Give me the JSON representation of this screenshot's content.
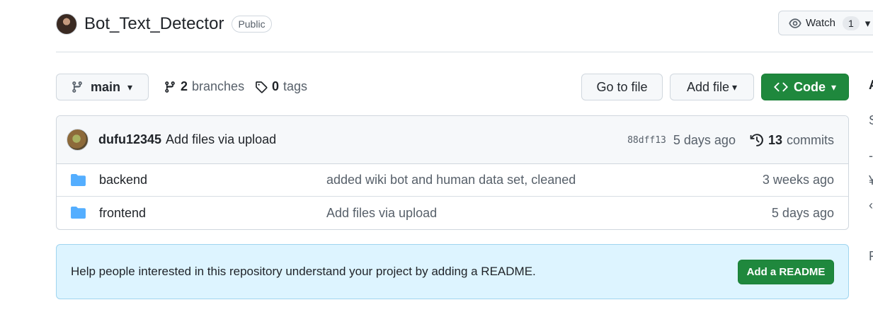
{
  "repo": {
    "name": "Bot_Text_Detector",
    "visibility": "Public"
  },
  "watch": {
    "label": "Watch",
    "count": "1"
  },
  "toolbar": {
    "branch": "main",
    "branches_count": "2",
    "branches_label": "branches",
    "tags_count": "0",
    "tags_label": "tags",
    "goto_file": "Go to file",
    "add_file": "Add file",
    "code": "Code"
  },
  "latest_commit": {
    "author": "dufu12345",
    "message": "Add files via upload",
    "sha": "88dff13",
    "age": "5 days ago",
    "commits_count": "13",
    "commits_label": "commits"
  },
  "files": [
    {
      "name": "backend",
      "commit_message": "added wiki bot and human data set, cleaned",
      "age": "3 weeks ago"
    },
    {
      "name": "frontend",
      "commit_message": "Add files via upload",
      "age": "5 days ago"
    }
  ],
  "readme_banner": {
    "text": "Help people interested in this repository understand your project by adding a README.",
    "button": "Add a README"
  },
  "colors": {
    "primary_green": "#1f883d",
    "folder_blue": "#54aeff",
    "banner_bg": "#ddf4ff"
  }
}
